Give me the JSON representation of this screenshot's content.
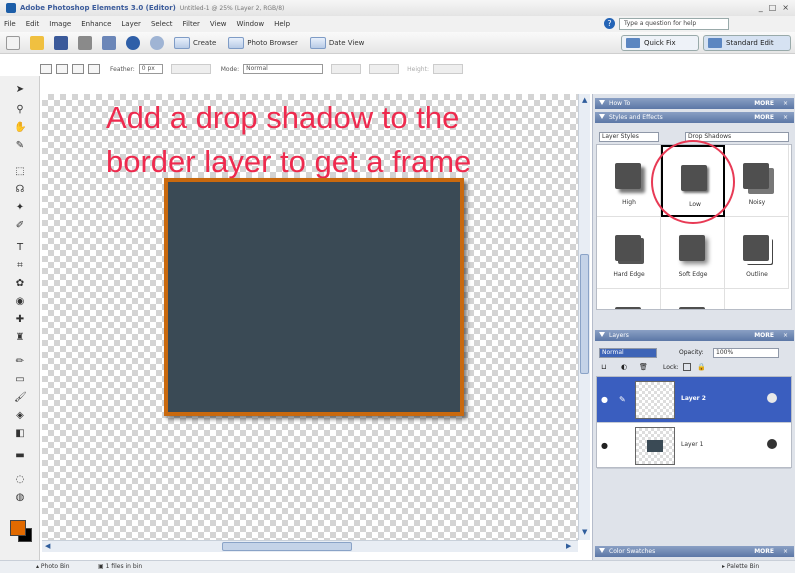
{
  "window": {
    "title": "Adobe Photoshop Elements 3.0 (Editor)",
    "document": "Untitled-1 @ 25% (Layer 2, RGB/8)",
    "controls": [
      "_",
      "□",
      "×"
    ]
  },
  "menu": [
    "File",
    "Edit",
    "Image",
    "Enhance",
    "Layer",
    "Select",
    "Filter",
    "View",
    "Window",
    "Help"
  ],
  "help": {
    "placeholder": "Type a question for help"
  },
  "toolbar": {
    "create": "Create",
    "photo_browser": "Photo Browser",
    "date_view": "Date View",
    "quick_fix": "Quick Fix",
    "standard_edit": "Standard Edit"
  },
  "options": {
    "feather_label": "Feather:",
    "feather_value": "0 px",
    "mode_label": "Mode:",
    "mode_value": "Normal",
    "height_label": "Height:"
  },
  "canvas": {
    "instruction_line1": "Add a drop shadow to the",
    "instruction_line2": "border layer to get a frame"
  },
  "colors": {
    "foreground": "#e26a00",
    "background": "#000000",
    "frame_fill": "#3a4a55",
    "frame_border": "#c9690e",
    "annotation": "#ee2a4e"
  },
  "panels": {
    "how_to": "How To",
    "styles": "Styles and Effects",
    "styles_category": "Layer Styles",
    "styles_library": "Drop Shadows",
    "more": "MORE",
    "layers": "Layers",
    "blend_mode": "Normal",
    "opacity_label": "Opacity:",
    "opacity_value": "100%",
    "lock_label": "Lock:",
    "color_swatches": "Color Swatches"
  },
  "styles": [
    {
      "label": "High"
    },
    {
      "label": "Low",
      "selected": true
    },
    {
      "label": "Noisy"
    },
    {
      "label": "Hard Edge"
    },
    {
      "label": "Soft Edge"
    },
    {
      "label": "Outline"
    },
    {
      "label": ""
    },
    {
      "label": ""
    }
  ],
  "layers": [
    {
      "name": "Layer 2",
      "active": true
    },
    {
      "name": "Layer 1",
      "active": false
    }
  ],
  "status": {
    "photo_bin": "Photo Bin",
    "files_in_bin": "1 files in bin",
    "palette_bin": "Palette Bin"
  }
}
